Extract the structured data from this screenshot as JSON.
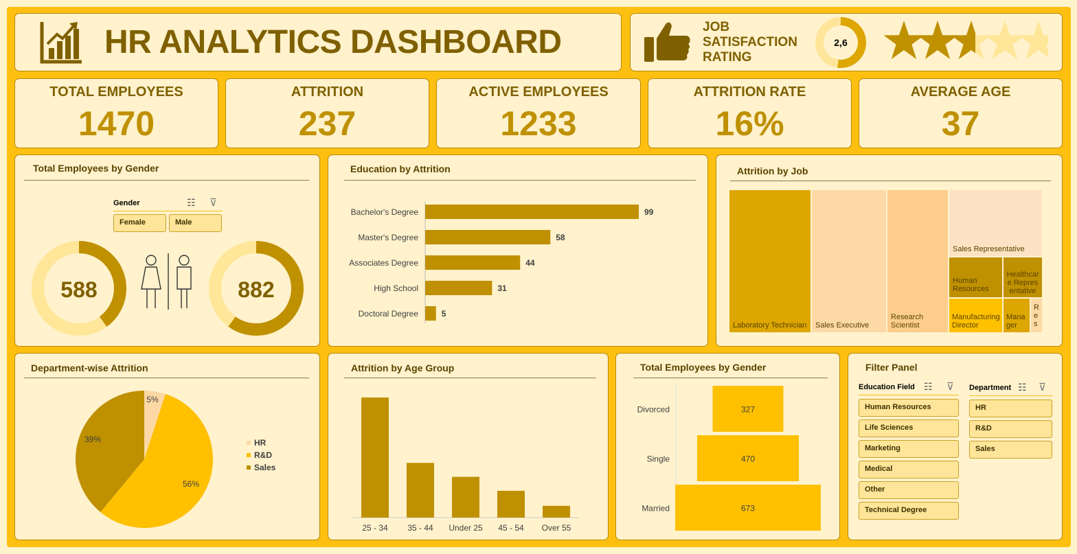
{
  "header": {
    "title": "HR ANALYTICS DASHBOARD"
  },
  "satisfaction": {
    "label_lines": [
      "JOB",
      "SATISFACTION",
      "RATING"
    ],
    "value": "2,6",
    "rating": 2.6,
    "max_stars": 5
  },
  "kpis": [
    {
      "label": "TOTAL EMPLOYEES",
      "value": "1470"
    },
    {
      "label": "ATTRITION",
      "value": "237"
    },
    {
      "label": "ACTIVE EMPLOYEES",
      "value": "1233"
    },
    {
      "label": "ATTRITION RATE",
      "value": "16%"
    },
    {
      "label": "AVERAGE AGE",
      "value": "37"
    }
  ],
  "gender_card": {
    "title": "Total Employees by Gender",
    "slicer": {
      "label": "Gender",
      "options": [
        "Female",
        "Male"
      ]
    },
    "female": "588",
    "male": "882"
  },
  "education_card": {
    "title": "Education by Attrition"
  },
  "job_card": {
    "title": "Attrition by Job"
  },
  "department_card": {
    "title": "Department-wise Attrition"
  },
  "age_card": {
    "title": "Attrition by Age Group"
  },
  "marital_card": {
    "title": "Total Employees by Gender"
  },
  "filter_panel": {
    "title": "Filter Panel",
    "education_field": {
      "label": "Education Field",
      "options": [
        "Human Resources",
        "Life Sciences",
        "Marketing",
        "Medical",
        "Other",
        "Technical Degree"
      ]
    },
    "department": {
      "label": "Department",
      "options": [
        "HR",
        "R&D",
        "Sales"
      ]
    }
  },
  "colors": {
    "gold_dark": "#bf9000",
    "gold": "#ffc000",
    "gold_mid": "#dda600",
    "cream": "#fff2cc",
    "peach": "#fdd8a5",
    "text_dark": "#7f6000"
  },
  "chart_data": [
    {
      "type": "pie",
      "title": "Total Employees by Gender",
      "categories": [
        "Female",
        "Male"
      ],
      "values": [
        588,
        882
      ]
    },
    {
      "type": "bar",
      "orientation": "horizontal",
      "title": "Education by Attrition",
      "categories": [
        "Bachelor's Degree",
        "Master's Degree",
        "Associates Degree",
        "High School",
        "Doctoral Degree"
      ],
      "values": [
        99,
        58,
        44,
        31,
        5
      ],
      "value_labels": [
        "99",
        "58",
        "44",
        "31",
        "5"
      ]
    },
    {
      "type": "heatmap",
      "subtype": "treemap",
      "title": "Attrition by Job",
      "categories": [
        "Laboratory Technician",
        "Sales Executive",
        "Research Scientist",
        "Sales Representative",
        "Human Resources",
        "Healthcare Representative",
        "Manufacturing Director",
        "Manager",
        "Research Director"
      ],
      "labels": [
        "Laboratory Technician",
        "Sales Executive",
        "Research Scientist",
        "Sales Representative",
        "Human Resources",
        "Healthcare Representative",
        "Manufacturing Director",
        "Manager",
        "Res"
      ],
      "values": [
        62,
        57,
        47,
        33,
        12,
        9,
        10,
        5,
        2
      ]
    },
    {
      "type": "pie",
      "title": "Department-wise Attrition",
      "categories": [
        "HR",
        "R&D",
        "Sales"
      ],
      "values": [
        5,
        56,
        39
      ],
      "value_labels": [
        "5%",
        "56%",
        "39%"
      ],
      "legend": "right"
    },
    {
      "type": "bar",
      "title": "Attrition by Age Group",
      "categories": [
        "25 - 34",
        "35 - 44",
        "Under 25",
        "45 - 54",
        "Over 55"
      ],
      "values": [
        112,
        51,
        38,
        25,
        11
      ]
    },
    {
      "type": "bar",
      "orientation": "horizontal",
      "subtype": "funnel",
      "title": "Total Employees by Gender",
      "categories": [
        "Divorced",
        "Single",
        "Married"
      ],
      "values": [
        327,
        470,
        673
      ],
      "value_labels": [
        "327",
        "470",
        "673"
      ]
    }
  ]
}
